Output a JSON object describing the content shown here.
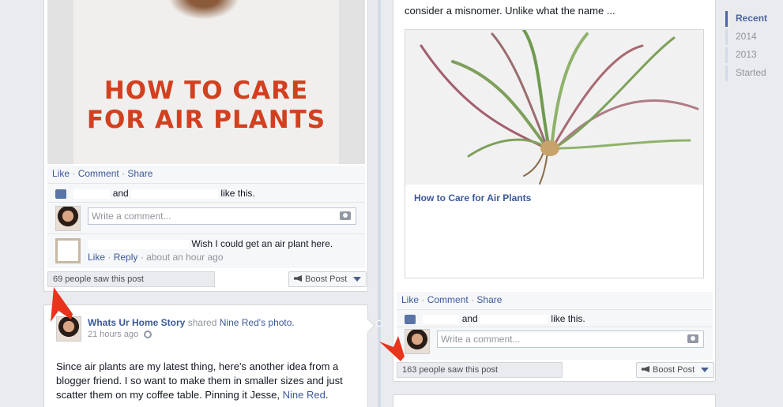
{
  "years_nav": [
    "Recent",
    "2014",
    "2013",
    "Started"
  ],
  "left_post": {
    "image_text_line1": "HOW TO CARE",
    "image_text_line2": "FOR AIR PLANTS",
    "actions": {
      "like": "Like",
      "comment": "Comment",
      "share": "Share"
    },
    "likes_and": "and",
    "likes_suffix": "like this.",
    "comment_placeholder": "Write a comment...",
    "comment_text": "Wish I could get an air plant here.",
    "comment_like": "Like",
    "comment_reply": "Reply",
    "comment_time": "about an hour ago",
    "seen": "69 people saw this post",
    "boost": "Boost Post"
  },
  "right_post": {
    "excerpt": "consider a misnomer. Unlike what the name ...",
    "link_title": "How to Care for Air Plants",
    "actions": {
      "like": "Like",
      "comment": "Comment",
      "share": "Share"
    },
    "likes_and": "and",
    "likes_suffix": "like this.",
    "comment_placeholder": "Write a comment...",
    "seen": "163 people saw this post",
    "boost": "Boost Post"
  },
  "story": {
    "author": "Whats Ur Home Story",
    "shared": "shared",
    "source": "Nine Red's photo.",
    "time": "21 hours ago",
    "body": "Since air plants are my latest thing, here's another idea from a blogger friend. I so want to make them in smaller sizes and just scatter them on my coffee table. Pinning it Jesse,",
    "mention": "Nine Red",
    "period": "."
  },
  "colors": {
    "accent": "#3b5998",
    "arrow": "#e8341c",
    "poster_text": "#d2401f"
  }
}
